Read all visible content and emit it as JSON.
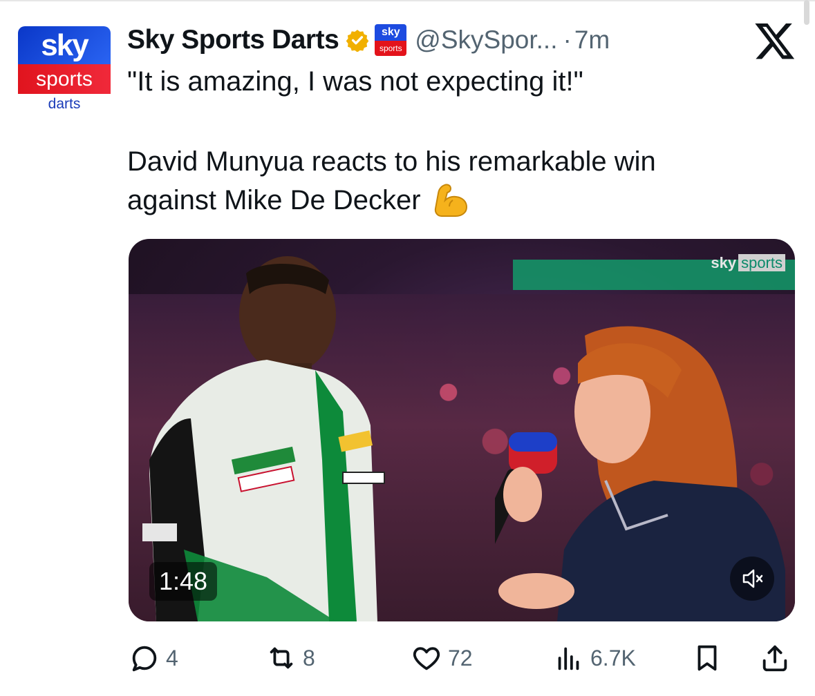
{
  "account": {
    "avatar_top": "sky",
    "avatar_mid": "sports",
    "avatar_bottom": "darts",
    "display_name": "Sky Sports Darts",
    "affiliate_top": "sky",
    "affiliate_bottom": "sports",
    "handle": "@SkySpor...",
    "separator": "·",
    "time": "7m"
  },
  "tweet": {
    "quote": "\"It is amazing, I was not expecting it!\"",
    "line1": "David Munyua reacts to his remarkable win",
    "line2": "against Mike De Decker"
  },
  "video": {
    "watermark_sky": "sky",
    "watermark_sports": "sports",
    "duration": "1:48"
  },
  "actions": {
    "replies": "4",
    "reposts": "8",
    "likes": "72",
    "views": "6.7K"
  },
  "colors": {
    "text": "#0f1419",
    "secondary": "#536471",
    "verified": "#f1b000",
    "sky_blue": "#1d4be0",
    "sky_red": "#e3131b"
  },
  "icons": {
    "verified": "verified-badge-icon",
    "x_logo": "x-logo-icon",
    "flex": "flexed-biceps-emoji",
    "mute": "muted-speaker-icon",
    "reply": "reply-icon",
    "repost": "repost-icon",
    "like": "heart-icon",
    "views": "views-chart-icon",
    "bookmark": "bookmark-icon",
    "share": "share-icon"
  }
}
